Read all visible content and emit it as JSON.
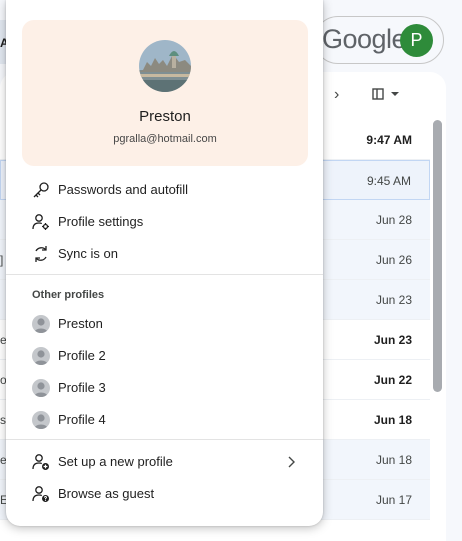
{
  "browser": {
    "google_logo": "Google",
    "account_initial": "P",
    "left_header_fragment": "A"
  },
  "inbox": {
    "rows": [
      {
        "date": "9:47 AM",
        "left_text": "",
        "state": "unread"
      },
      {
        "date": "9:45 AM",
        "left_text": "",
        "state": "selected"
      },
      {
        "date": "Jun 28",
        "left_text": "",
        "state": "read"
      },
      {
        "date": "Jun 26",
        "left_text": "]",
        "state": "read"
      },
      {
        "date": "Jun 23",
        "left_text": "",
        "state": "read"
      },
      {
        "date": "Jun 23",
        "left_text": "e",
        "state": "unread"
      },
      {
        "date": "Jun 22",
        "left_text": "o",
        "state": "unread"
      },
      {
        "date": "Jun 18",
        "left_text": "s",
        "state": "unread"
      },
      {
        "date": "Jun 18",
        "left_text": "e",
        "state": "read"
      },
      {
        "date": "Jun 17",
        "left_text": "E",
        "state": "read"
      }
    ]
  },
  "profile_menu": {
    "name": "Preston",
    "email": "pgralla@hotmail.com",
    "passwords_label": "Passwords and autofill",
    "profile_settings_label": "Profile settings",
    "sync_label": "Sync is on",
    "other_profiles_heading": "Other profiles",
    "other_profiles": [
      "Preston",
      "Profile 2",
      "Profile 3",
      "Profile 4"
    ],
    "new_profile_label": "Set up a new profile",
    "guest_label": "Browse as guest"
  },
  "colors": {
    "card_background": "#fdf0e7",
    "avatar_green": "#2e8b3a"
  }
}
